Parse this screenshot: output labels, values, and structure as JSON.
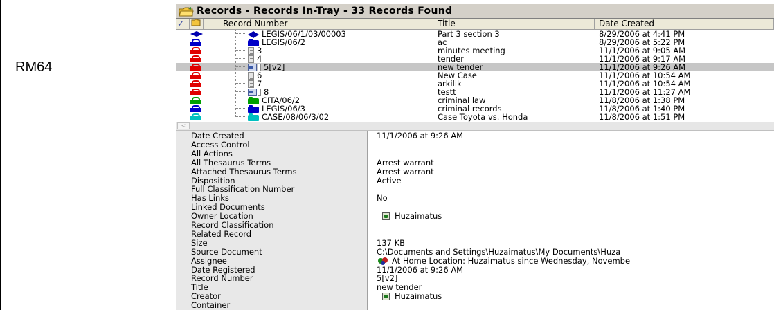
{
  "row_label": "RM64",
  "window": {
    "title": "Records - Records In-Tray - 33 Records Found",
    "columns": {
      "check": "✓",
      "record_number": "Record Number",
      "title": "Title",
      "date_created": "Date Created"
    }
  },
  "colors": {
    "red": "#e00000",
    "blue": "#0000c8",
    "green": "#00a000",
    "cyan": "#00c0c0",
    "selected_row": "#c6c6c6",
    "label_panel": "#e8e8e8"
  },
  "records": [
    {
      "lock_color": "diamond",
      "icon": "diamond",
      "record_number": "LEGIS/06/1/03/00003",
      "title": "Part 3 section 3",
      "date_created": "8/29/2006 at 4:41 PM"
    },
    {
      "lock_color": "#0000c8",
      "icon": "folder-blue",
      "record_number": "LEGIS/06/2",
      "title": "ac",
      "date_created": "8/29/2006 at 5:22 PM"
    },
    {
      "lock_color": "#e00000",
      "icon": "document",
      "record_number": "3",
      "title": "minutes meeting",
      "date_created": "11/1/2006 at 9:05 AM"
    },
    {
      "lock_color": "#e00000",
      "icon": "document",
      "record_number": "4",
      "title": "tender",
      "date_created": "11/1/2006 at 9:17 AM"
    },
    {
      "lock_color": "#e00000",
      "icon": "document-version",
      "record_number": "5[v2]",
      "title": "new tender",
      "date_created": "11/1/2006 at 9:26 AM",
      "selected": true
    },
    {
      "lock_color": "#e00000",
      "icon": "document",
      "record_number": "6",
      "title": "New Case",
      "date_created": "11/1/2006 at 10:54 AM"
    },
    {
      "lock_color": "#e00000",
      "icon": "document",
      "record_number": "7",
      "title": "arkilik",
      "date_created": "11/1/2006 at 10:54 AM"
    },
    {
      "lock_color": "#e00000",
      "icon": "document-version",
      "record_number": "8",
      "title": "testt",
      "date_created": "11/1/2006 at 11:27 AM"
    },
    {
      "lock_color": "#00a000",
      "icon": "folder-green",
      "record_number": "CITA/06/2",
      "title": "criminal law",
      "date_created": "11/8/2006 at 1:38 PM"
    },
    {
      "lock_color": "#0000c8",
      "icon": "folder-blue",
      "record_number": "LEGIS/06/3",
      "title": "criminal records",
      "date_created": "11/8/2006 at 1:40 PM"
    },
    {
      "lock_color": "#00c0c0",
      "icon": "folder-cyan",
      "record_number": "CASE/08/06/3/02",
      "title": "Case Toyota vs. Honda",
      "date_created": "11/8/2006 at 1:51 PM"
    }
  ],
  "scroll": {
    "left_arrow": "<"
  },
  "properties": [
    {
      "label": "Date Created",
      "value": "11/1/2006 at 9:26 AM"
    },
    {
      "label": "Access Control",
      "value": ""
    },
    {
      "label": "All Actions",
      "value": ""
    },
    {
      "label": "All Thesaurus Terms",
      "value": "Arrest warrant"
    },
    {
      "label": "Attached Thesaurus Terms",
      "value": "Arrest warrant"
    },
    {
      "label": "Disposition",
      "value": "Active"
    },
    {
      "label": "Full Classification Number",
      "value": ""
    },
    {
      "label": "Has Links",
      "value": "No"
    },
    {
      "label": "Linked Documents",
      "value": ""
    },
    {
      "label": "Owner Location",
      "value": "Huzaimatus",
      "icon": "user-icon"
    },
    {
      "label": "Record Classification",
      "value": ""
    },
    {
      "label": "Related Record",
      "value": ""
    },
    {
      "label": "Size",
      "value": "137 KB"
    },
    {
      "label": "Source Document",
      "value": "C:\\Documents and Settings\\Huzaimatus\\My Documents\\Huza"
    },
    {
      "label": "Assignee",
      "value": "At Home Location: Huzaimatus since Wednesday, Novembe",
      "icon": "home-location-icon"
    },
    {
      "label": "Date Registered",
      "value": "11/1/2006 at 9:26 AM"
    },
    {
      "label": "Record Number",
      "value": "5[v2]"
    },
    {
      "label": "Title",
      "value": "new tender"
    },
    {
      "label": "Creator",
      "value": "Huzaimatus",
      "icon": "user-icon"
    },
    {
      "label": "Container",
      "value": ""
    }
  ]
}
